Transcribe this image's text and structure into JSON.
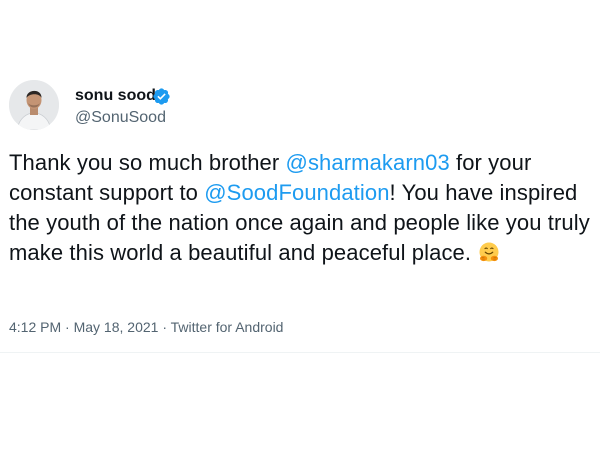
{
  "author": {
    "display_name": "sonu sood",
    "handle": "@SonuSood",
    "verified_icon": "verified-badge-icon"
  },
  "tweet": {
    "text_1": "Thank you so much brother ",
    "mention_1": "@sharmakarn03",
    "text_2": " for your constant support to ",
    "mention_2": "@SoodFoundation",
    "text_3": "! You have inspired the youth of the nation once again and people like you truly make this world a beautiful and peaceful place.",
    "emoji": "hugging-face-icon"
  },
  "meta": {
    "time": "4:12 PM",
    "separator_1": " · ",
    "date": "May 18, 2021",
    "separator_2": " · ",
    "source": "Twitter for Android"
  },
  "colors": {
    "link": "#1d9bf0",
    "text": "#0f1419",
    "secondary": "#536471",
    "verified": "#1d9bf0"
  }
}
